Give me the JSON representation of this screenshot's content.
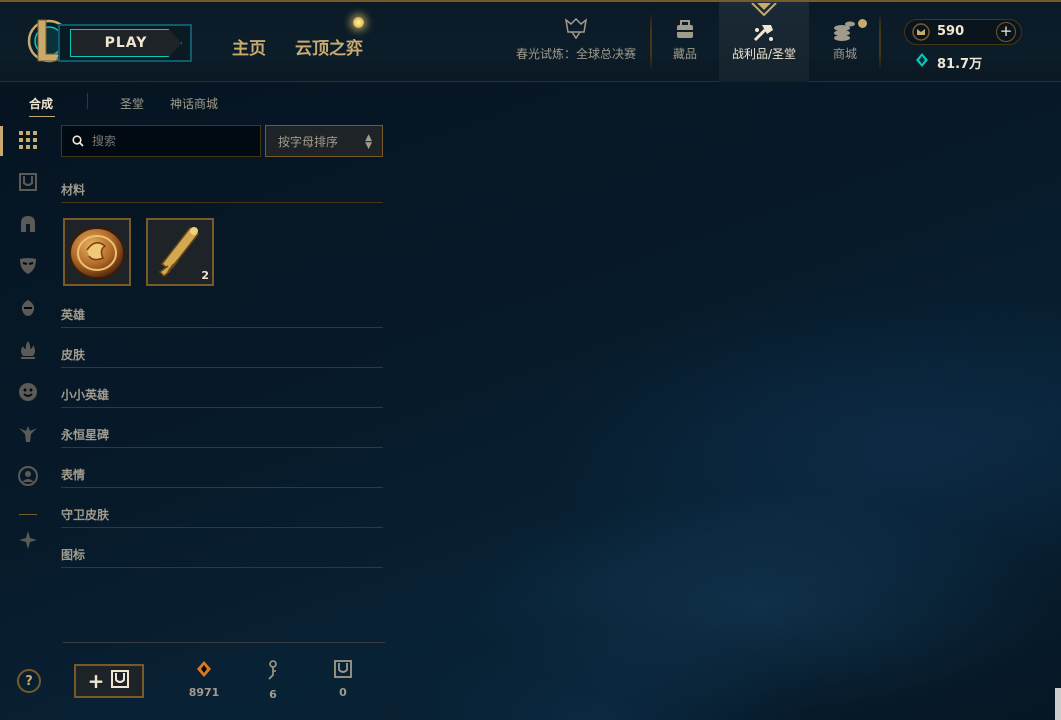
{
  "topbar": {
    "play_label": "PLAY",
    "nav_home": "主页",
    "nav_tft": "云顶之弈",
    "nav_event": "春光试炼：全球总决赛",
    "nav_collection": "藏品",
    "nav_loot": "战利品/圣堂",
    "nav_store": "商城",
    "currency_rp": "590",
    "currency_be": "81.7万",
    "accent_gold": "#c8aa6e",
    "accent_blue": "#0ac8b9"
  },
  "subnav": {
    "tabs": [
      {
        "label": "合成"
      },
      {
        "label": "圣堂"
      },
      {
        "label": "神话商城"
      }
    ]
  },
  "panel": {
    "search_placeholder": "搜索",
    "sort_label": "按字母排序",
    "sections": [
      {
        "label": "材料"
      },
      {
        "label": "英雄"
      },
      {
        "label": "皮肤"
      },
      {
        "label": "小小英雄"
      },
      {
        "label": "永恒星碑"
      },
      {
        "label": "表情"
      },
      {
        "label": "守卫皮肤"
      },
      {
        "label": "图标"
      }
    ],
    "materials": [
      {
        "icon": "orb-icon",
        "count": ""
      },
      {
        "icon": "key-icon",
        "count": "2"
      }
    ]
  },
  "footer": {
    "add_label": "+",
    "orange_essence": "8971",
    "key_fragments": "6",
    "chests": "0",
    "help_label": "?"
  }
}
